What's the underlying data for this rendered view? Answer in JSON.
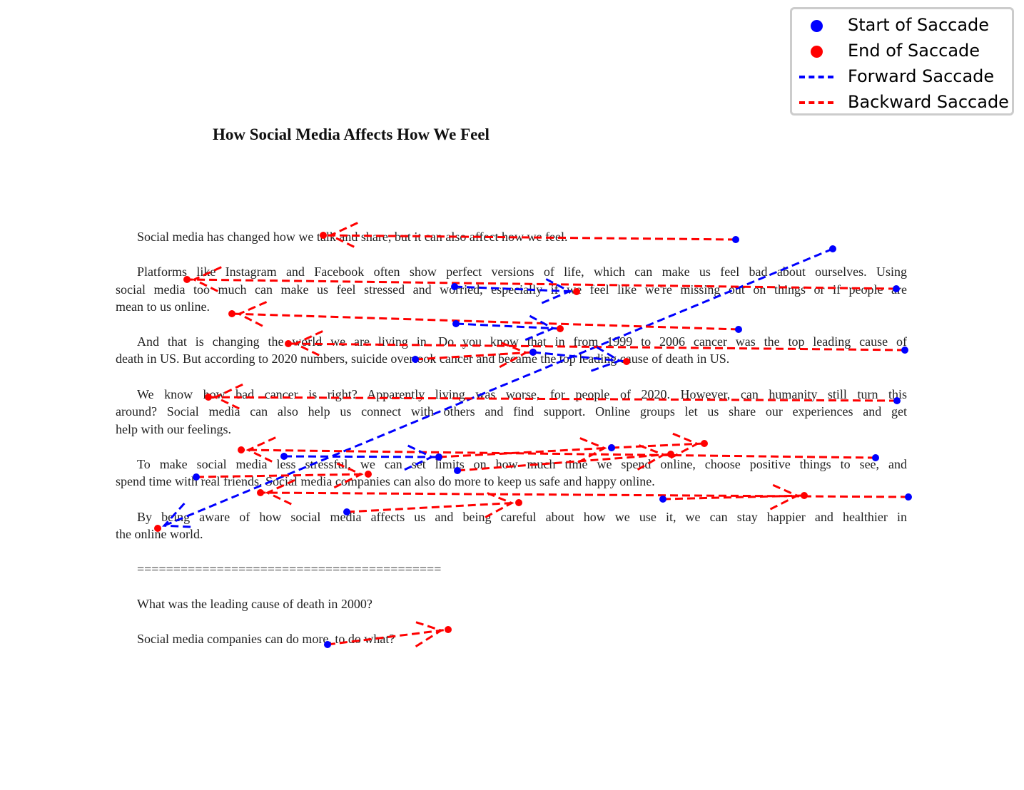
{
  "title": "How Social Media Affects How We Feel",
  "text_lines": [
    "Social media has changed how we talk and share, but it can also affect how we feel.",
    "Platforms like Instagram and Facebook often show perfect versions of life, which can make us feel bad about ourselves. Using",
    "social media too much can make us feel stressed and worried, especially if we feel like we're missing out on things or if people are",
    "mean to us online.",
    "And that is changing the world we are living in. Do you know that in from 1999 to 2006 cancer was the top leading cause of",
    "death in US. But according to 2020 numbers, suicide overtook cancer and became the top leading cause of death in US.",
    "We know how bad cancer is right? Apparently living was worse, for people of 2020. However, can humanity still turn this",
    "around? Social media can also help us connect with others and find support. Online groups let us share our experiences and get",
    "help with our feelings.",
    "To make social media less stressful, we can set limits on how much time we spend online, choose positive things to see, and",
    "spend time with real friends. Social media companies can also do more to keep us safe and happy online.",
    "By being aware of how social media affects us and being careful about how we use it, we can stay happier and healthier in",
    "the online world.",
    "==========================================",
    "What was the leading cause of death in 2000?",
    "Social media companies can do more, to do what?"
  ],
  "legend": {
    "start": "Start of Saccade",
    "end": "End of Saccade",
    "forward": "Forward Saccade",
    "backward": "Backward Saccade"
  },
  "colors": {
    "start": "#0000ff",
    "end": "#ff0000",
    "forward": "#0000ff",
    "backward": "#ff0000"
  }
}
